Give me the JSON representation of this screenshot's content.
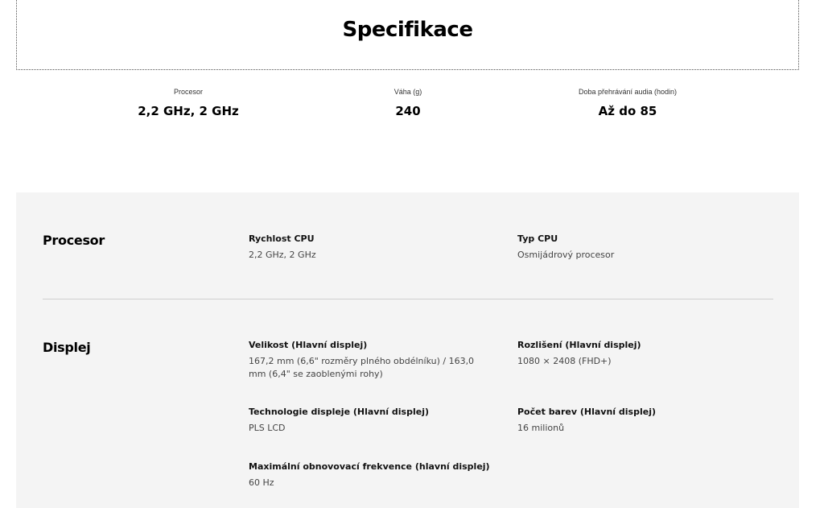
{
  "header": {
    "title": "Specifikace"
  },
  "highlights": [
    {
      "label": "Procesor",
      "value": "2,2 GHz, 2 GHz"
    },
    {
      "label": "Váha (g)",
      "value": "240"
    },
    {
      "label": "Doba přehrávání audia (hodin)",
      "value": "Až do 85"
    }
  ],
  "sections": [
    {
      "title": "Procesor",
      "items": [
        {
          "label": "Rychlost CPU",
          "value": "2,2 GHz, 2 GHz"
        },
        {
          "label": "Typ CPU",
          "value": "Osmijádrový procesor"
        }
      ]
    },
    {
      "title": "Displej",
      "items": [
        {
          "label": "Velikost (Hlavní displej)",
          "value": "167,2 mm (6,6\" rozměry plného obdélníku) / 163,0 mm (6,4\" se zaoblenými rohy)"
        },
        {
          "label": "Rozlišení (Hlavní displej)",
          "value": "1080 × 2408 (FHD+)"
        },
        {
          "label": "Technologie displeje (Hlavní displej)",
          "value": "PLS LCD"
        },
        {
          "label": "Počet barev (Hlavní displej)",
          "value": "16 milionů"
        },
        {
          "label": "Maximální obnovovací frekvence (hlavní displej)",
          "value": "60 Hz"
        }
      ]
    }
  ],
  "colors": {
    "panel_background": "#f4f4f4",
    "divider": "#cfcfcf"
  }
}
